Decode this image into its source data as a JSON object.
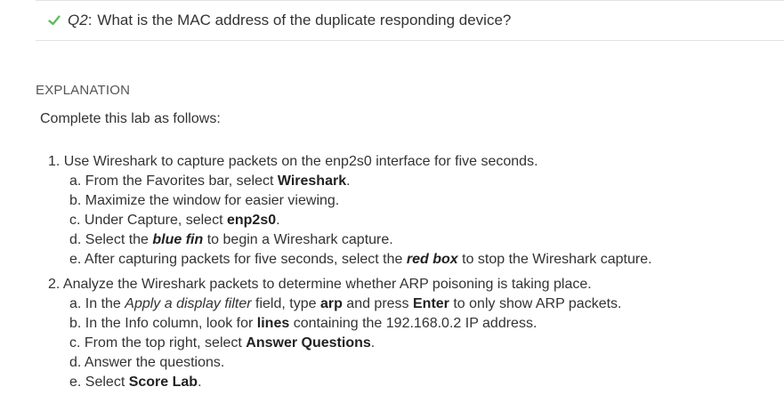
{
  "question": {
    "number": "Q2",
    "colon": ":",
    "text": "What is the MAC address of the duplicate responding device?"
  },
  "icons": {
    "status": "check-icon",
    "status_color": "#5cb85c"
  },
  "explanation": {
    "heading": "EXPLANATION",
    "intro": "Complete this lab as follows:",
    "steps": [
      {
        "text": "1. Use Wireshark to capture packets on the enp2s0 interface for five seconds.",
        "subs": [
          {
            "pre": "a. From the Favorites bar, select ",
            "b": "Wireshark",
            "post": "."
          },
          {
            "pre": "b. Maximize the window for easier viewing."
          },
          {
            "pre": "c. Under Capture, select ",
            "b": "enp2s0",
            "post": "."
          },
          {
            "pre": "d. Select the ",
            "bi": "blue fin",
            "post": " to begin a Wireshark capture."
          },
          {
            "pre": "e. After capturing packets for five seconds, select the ",
            "bi": "red box",
            "post": " to stop the Wireshark capture."
          }
        ]
      },
      {
        "text": "2. Analyze the Wireshark packets to determine whether ARP poisoning is taking place.",
        "subs": [
          {
            "pre": "a. In the ",
            "i": "Apply a display filter",
            "mid": " field, type ",
            "b": "arp",
            "mid2": " and press ",
            "b2": "Enter",
            "post": " to only show ARP packets."
          },
          {
            "pre": "b. In the Info column, look for ",
            "b": "lines",
            "post": " containing the 192.168.0.2 IP address."
          },
          {
            "pre": "c. From the top right, select ",
            "b": "Answer Questions",
            "post": "."
          },
          {
            "pre": "d. Answer the questions."
          },
          {
            "pre": "e. Select ",
            "b": "Score Lab",
            "post": "."
          }
        ]
      }
    ]
  }
}
